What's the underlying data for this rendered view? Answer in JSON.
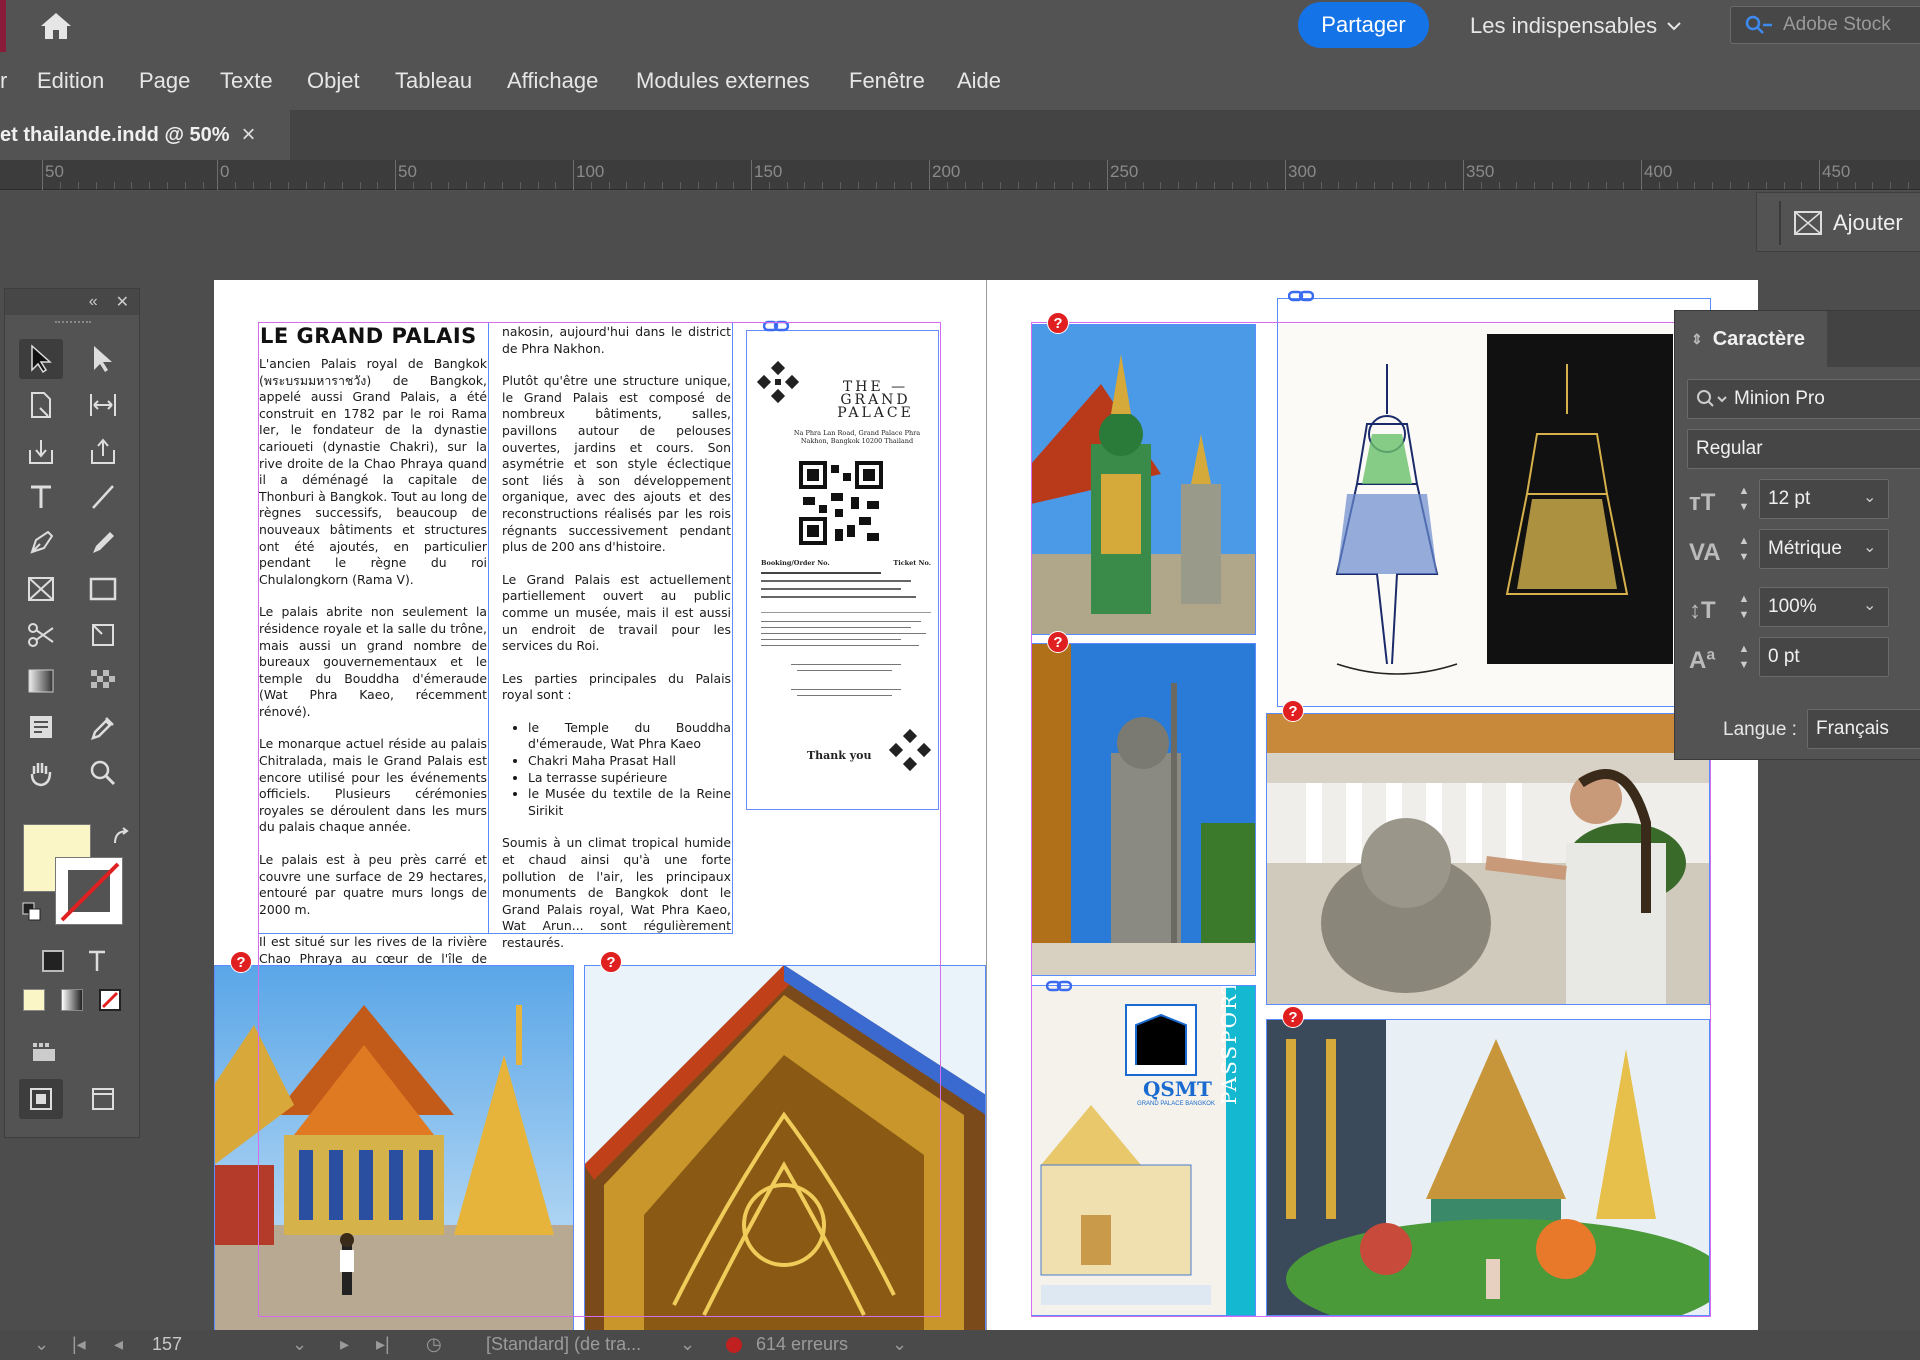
{
  "topbar": {
    "share_label": "Partager",
    "workspace_label": "Les indispensables",
    "search_placeholder": "Adobe Stock"
  },
  "menu": {
    "items": [
      "r",
      "Edition",
      "Page",
      "Texte",
      "Objet",
      "Tableau",
      "Affichage",
      "Modules externes",
      "Fenêtre",
      "Aide"
    ]
  },
  "tab": {
    "title": "et thailande.indd @ 50%",
    "close": "×"
  },
  "ruler": {
    "labels": [
      "50",
      "0",
      "50",
      "100",
      "150",
      "200",
      "250",
      "300",
      "350",
      "400",
      "450"
    ]
  },
  "ajouter": {
    "label": "Ajouter"
  },
  "character_panel": {
    "title": "Caractère",
    "font_family": "Minion Pro",
    "font_style": "Regular",
    "font_size": "12 pt",
    "kerning": "Métrique",
    "vertical_scale": "100%",
    "baseline_shift": "0 pt",
    "language_label": "Langue :",
    "language": "Français"
  },
  "document": {
    "title": "LE GRAND PALAIS",
    "col1": [
      "L'ancien Palais royal de Bangkok (พระบรมมหาราชวัง) de Bangkok, appelé aussi Grand Palais, a été construit en 1782 par le roi Rama Ier, le fondateur de la dynastie carioueti (dynastie Chakri), sur la rive droite de la Chao Phraya quand il a déménagé la capitale de Thonburi à Bangkok. Tout au long de règnes successifs, beaucoup de nouveaux bâtiments et structures ont été ajoutés, en particulier pendant le règne du roi Chulalongkorn (Rama V).",
      "Le palais abrite non seulement la résidence royale et la salle du trône, mais aussi un grand nombre de bureaux gouvernementaux et le temple du Bouddha d'émeraude (Wat Phra Kaeo, récemment rénové).",
      "Le monarque actuel réside au palais Chitralada, mais le Grand Palais est encore utilisé pour les événements officiels. Plusieurs cérémonies royales se déroulent dans les murs du palais chaque année.",
      "Le palais est à peu près carré et couvre une surface de 29 hectares, entouré par quatre murs longs de 2000 m.",
      "Il est situé sur les rives de la rivière Chao Phraya au cœur de l'île de Ratta-"
    ],
    "col2": [
      "nakosin, aujourd'hui dans le district de Phra Nakhon.",
      "Plutôt qu'être une structure unique, le Grand Palais est composé de nombreux bâtiments, salles, pavillons autour de pelouses ouvertes, jardins et cours. Son asymétrie et son style éclectique sont liés à son développement organique, avec des ajouts et des reconstructions réalisés par les rois régnants successivement pendant plus de 200 ans d'histoire.",
      "Le Grand Palais est actuellement partiellement ouvert au public comme un musée, mais il est aussi un endroit de travail pour les services du Roi.",
      "Les parties principales du Palais royal sont :"
    ],
    "list": [
      "le Temple du Bouddha d'émeraude, Wat Phra Kaeo",
      "Chakri Maha Prasat Hall",
      "La terrasse supérieure",
      "le Musée du textile de la Reine Sirikit"
    ],
    "col2_end": "Soumis à un climat tropical humide et chaud ainsi qu'à une forte pollution de l'air, les principaux monuments de Bangkok dont le Grand Palais royal, Wat Phra Kaeo, Wat Arun... sont régulièrement restaurés.",
    "ticket": {
      "name": "THE — GRAND PALACE",
      "address": "Na Phra Lan Road, Grand Palace Phra Nakhon, Bangkok 10200 Thailand",
      "booking": "Booking/Order No.",
      "ticket_no": "Ticket No.",
      "thanks": "Thank you"
    },
    "passport": {
      "brand": "QSMT",
      "sub": "GRAND PALACE BANGKOK",
      "side": "PASSPORT"
    }
  },
  "status": {
    "page": "157",
    "style": "[Standard] (de tra...",
    "errors": "614 erreurs"
  },
  "colors": {
    "accent": "#1473e6",
    "error": "#e02020",
    "fill_swatch": "#fbf6c6",
    "frame": "#5a8cff",
    "margin": "#d46cf0"
  }
}
